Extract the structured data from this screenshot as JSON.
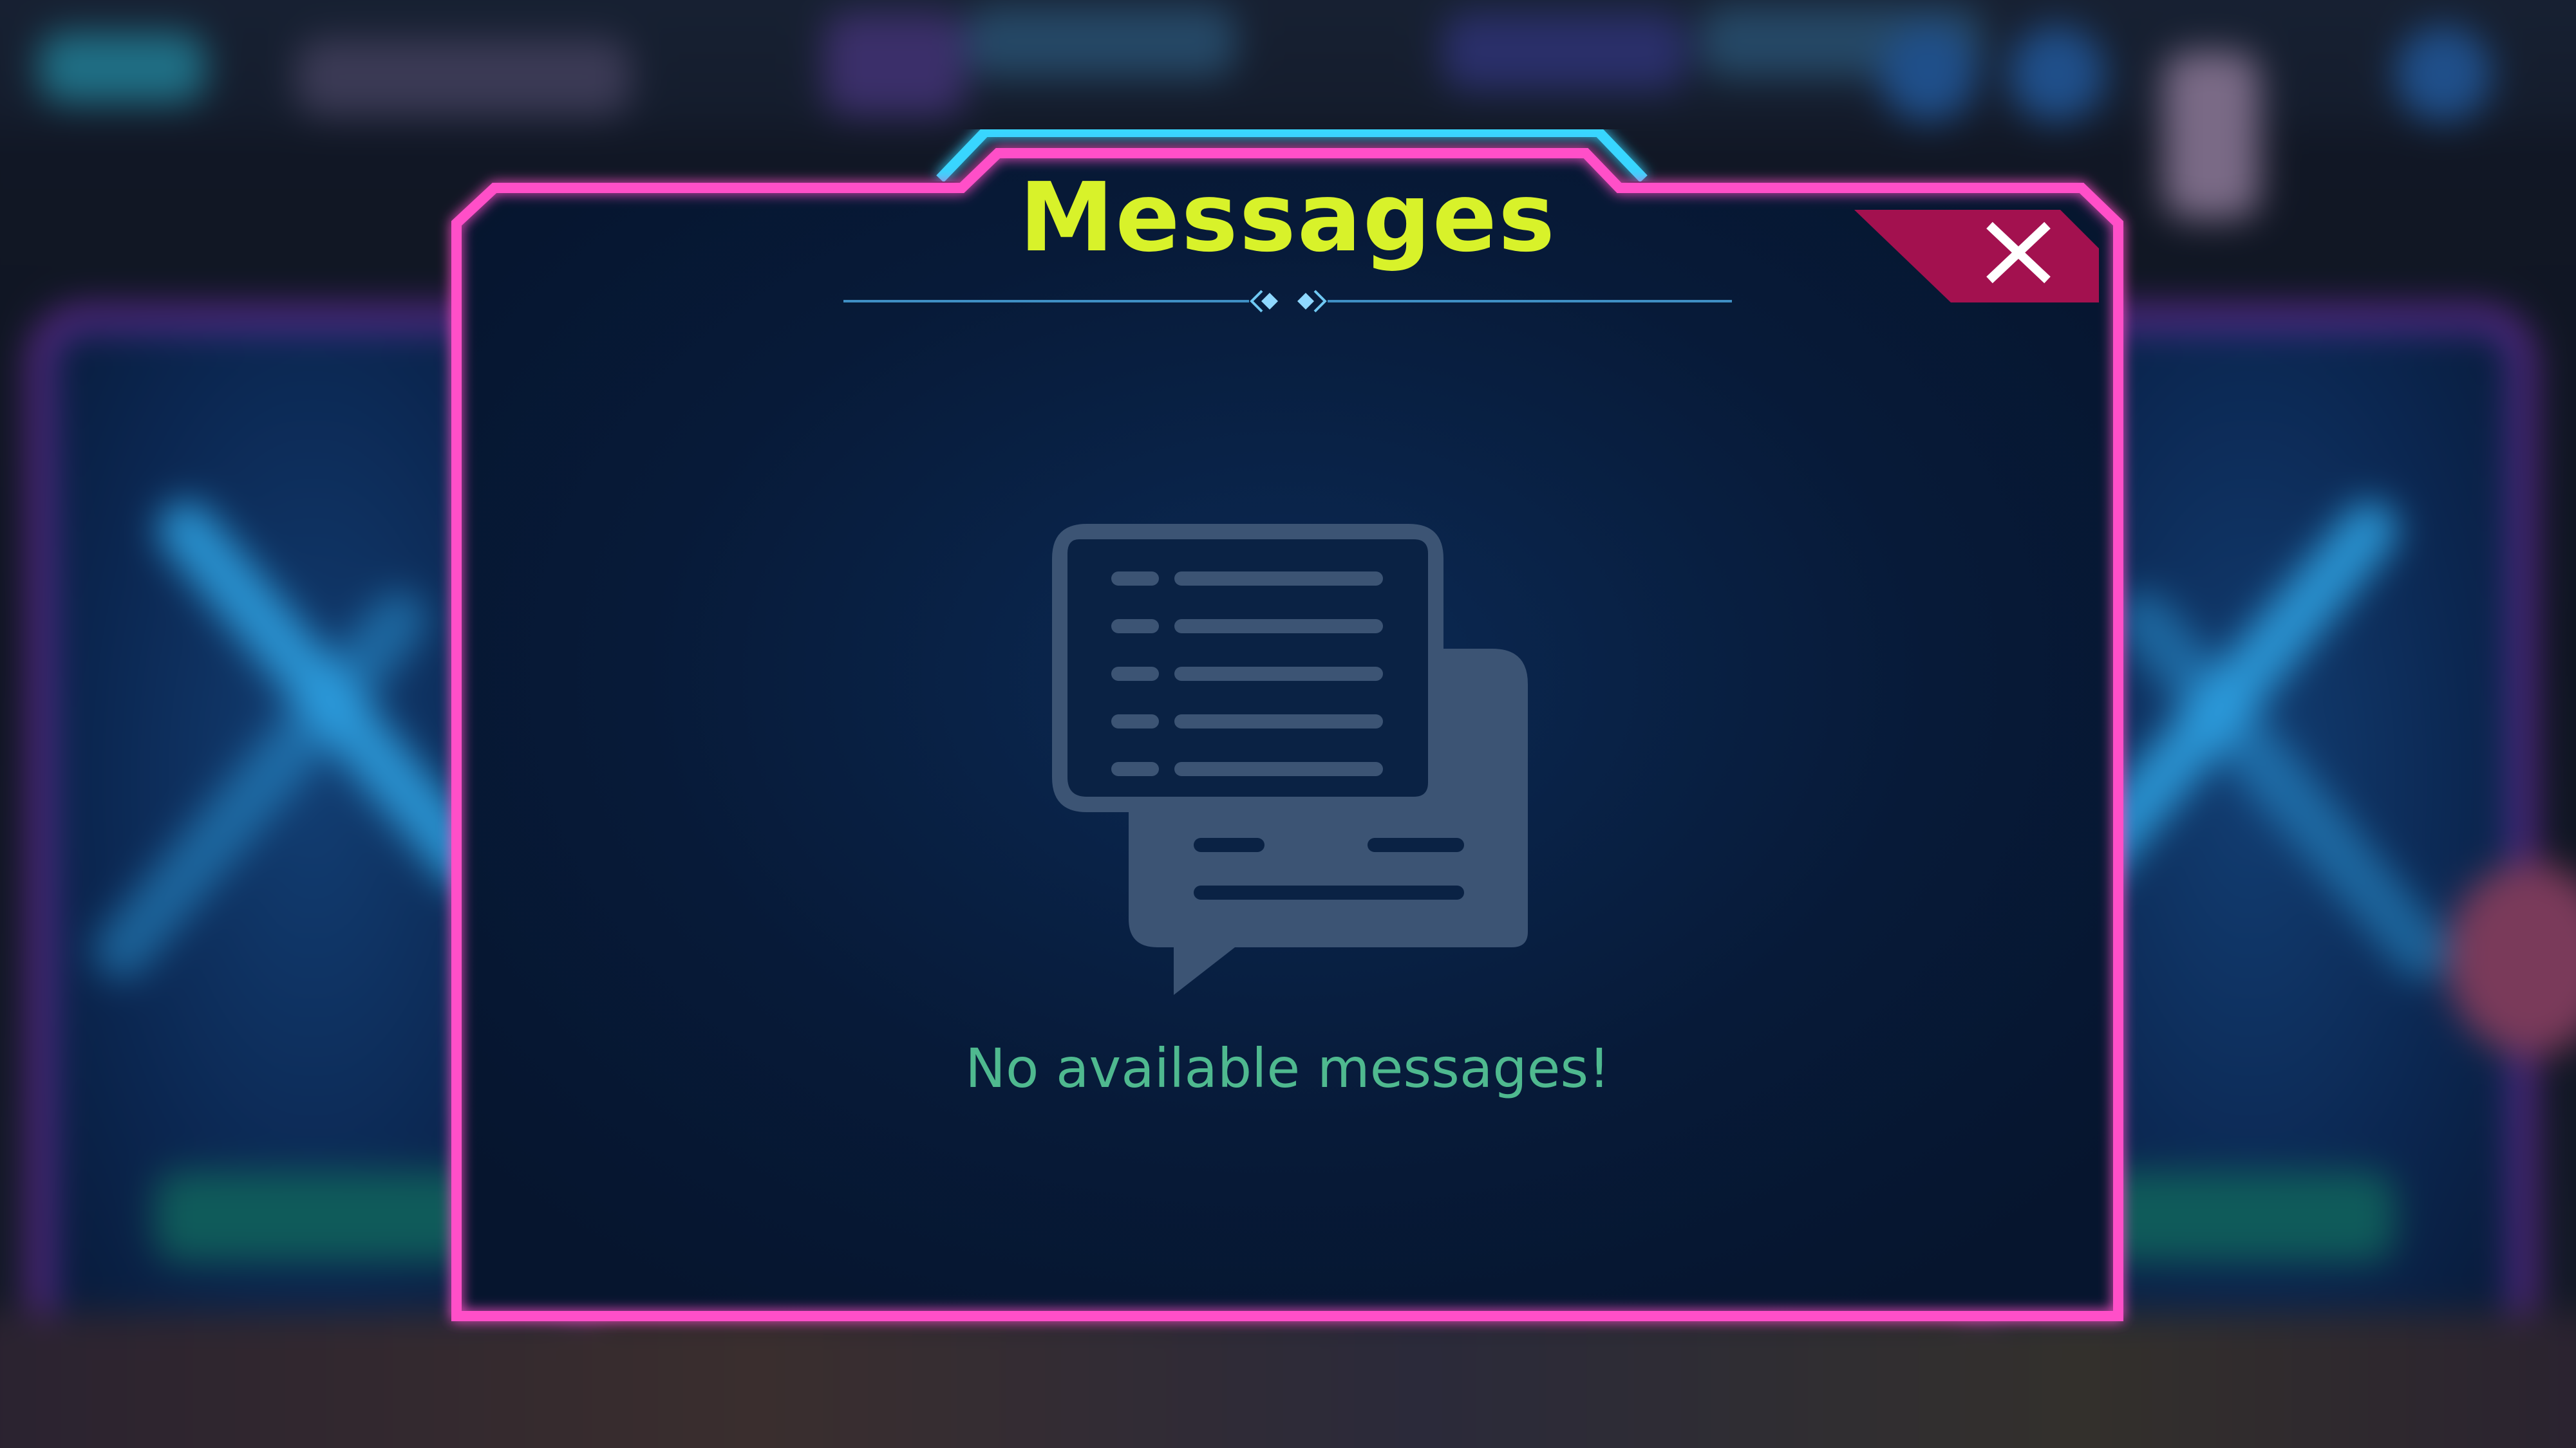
{
  "modal": {
    "title": "Messages",
    "close_icon": "close-x-icon",
    "empty_state": {
      "icon": "chat-bubbles-icon",
      "text": "No available messages!"
    }
  },
  "colors": {
    "frame_border": "#ff4fc8",
    "frame_top_accent": "#38d6ff",
    "panel_bg": "#071a38",
    "title": "#d8f22a",
    "close_button_bg": "#a3114f",
    "close_icon": "#ffffff",
    "empty_icon": "#3c5474",
    "empty_text": "#4fb98f"
  }
}
